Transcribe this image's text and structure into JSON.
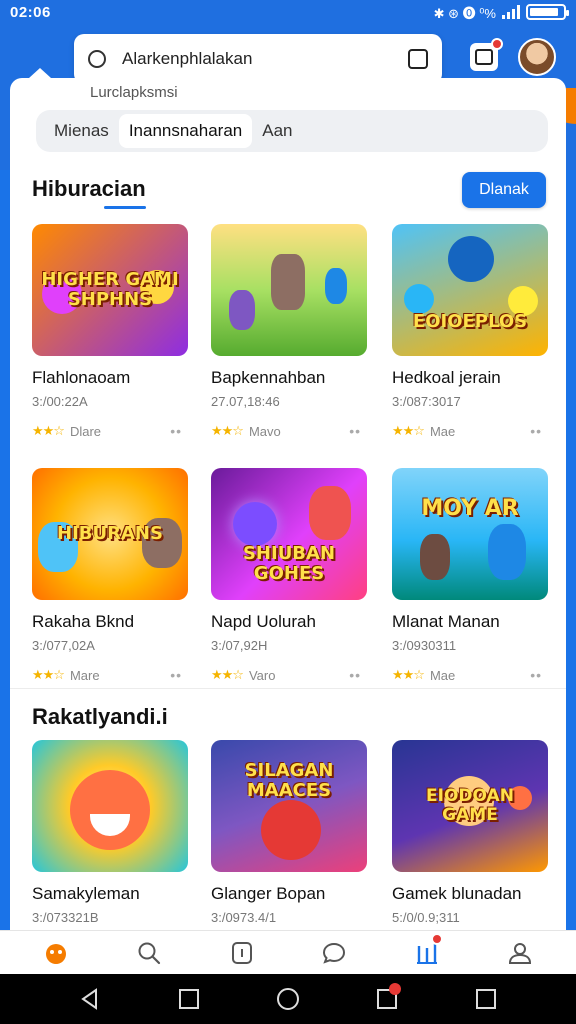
{
  "status": {
    "time": "02:06",
    "icons_text": "✱ ⊛ ⓿ ⁰%"
  },
  "header": {
    "search_text": "Alarkenphlalakan",
    "subtitle": "Lurclapksmsi"
  },
  "filters": [
    "Mienas",
    "Inannsnaharan",
    "Aan"
  ],
  "section1": {
    "title": "Hiburacian",
    "see_all": "Dlanak",
    "items": [
      {
        "thumb_label": "HIGHER GAMI SHPHNS",
        "name": "Flahlonaoam",
        "meta": "3:/00:22A",
        "more": "Dlare",
        "rating": 3,
        "colors": [
          "#ff8a00",
          "#8e2de2"
        ]
      },
      {
        "thumb_label": "",
        "name": "Bapkennahban",
        "meta": "27.07,18:46",
        "more": "Mavo",
        "rating": 3,
        "colors": [
          "#a8e063",
          "#56ab2f"
        ]
      },
      {
        "thumb_label": "EOIOEPLOS",
        "name": "Hedkoal jerain",
        "meta": "3:/087:3017",
        "more": "Mae",
        "rating": 3,
        "colors": [
          "#4fc3f7",
          "#ffb300"
        ]
      },
      {
        "thumb_label": "HIBURANS",
        "name": "Rakaha Bknd",
        "meta": "3:/077,02A",
        "more": "Mare",
        "rating": 3,
        "colors": [
          "#ffb300",
          "#ff5722"
        ]
      },
      {
        "thumb_label": "SHIUBAN GOHES",
        "name": "Napd Uolurah",
        "meta": "3:/07,92H",
        "more": "Varo",
        "rating": 3,
        "colors": [
          "#8e24aa",
          "#ff4081"
        ]
      },
      {
        "thumb_label": "MOY AR",
        "name": "Mlanat Manan",
        "meta": "3:/0930311",
        "more": "Mae",
        "rating": 3,
        "colors": [
          "#29b6f6",
          "#00897b"
        ]
      }
    ]
  },
  "section2": {
    "title": "Rakatlyandi.i",
    "items": [
      {
        "thumb_label": "",
        "name": "Samakyleman",
        "meta": "3:/073321B",
        "colors": [
          "#ffca28",
          "#26c6da"
        ]
      },
      {
        "thumb_label": "SILAGAN MAACES",
        "name": "Glanger Bopan",
        "meta": "3:/0973.4/1",
        "colors": [
          "#3949ab",
          "#ec407a"
        ]
      },
      {
        "thumb_label": "EIODOAN GAME",
        "name": "Gamek blunadan",
        "meta": "5:/0/0.9;311",
        "colors": [
          "#283593",
          "#ff9800"
        ]
      }
    ]
  },
  "nav": [
    "home",
    "search",
    "library",
    "chat",
    "ranking",
    "profile"
  ]
}
